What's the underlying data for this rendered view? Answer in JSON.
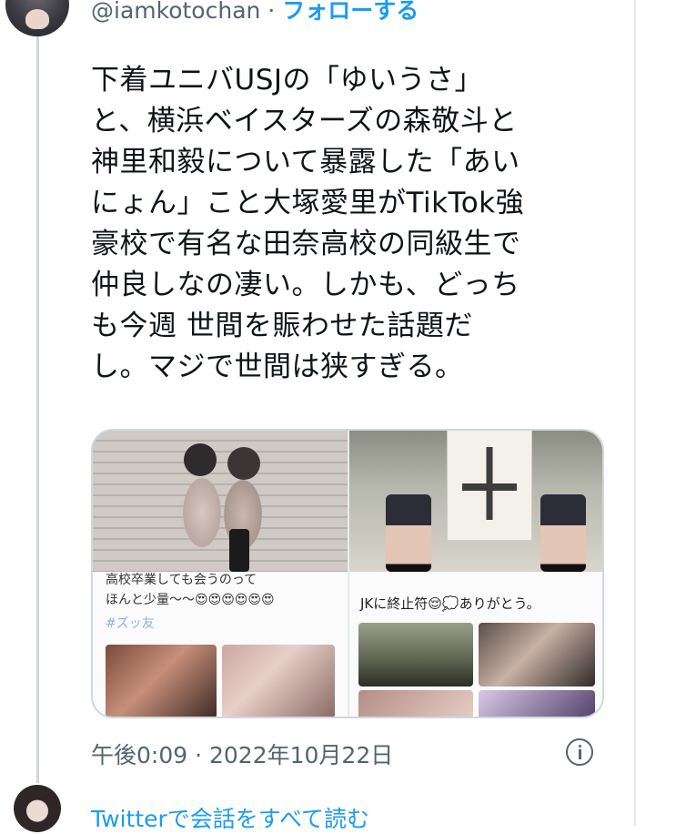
{
  "tweet": {
    "handle": "@iamkotochan",
    "separator": "·",
    "follow_label": "フォローする",
    "text_lines": [
      "下着ユニバUSJの「ゆいうさ」",
      "と、横浜ベイスターズの森敬斗と",
      "神里和毅について暴露した「あい",
      "にょん」こと大塚愛里がTikTok強",
      "豪校で有名な田奈高校の同級生で",
      "仲良しなの凄い。しかも、どっち",
      "も今週 世間を賑わせた話題だ",
      "し。マジで世間は狭すぎる。"
    ],
    "timestamp": "午後0:09 · 2022年10月22日"
  },
  "media": {
    "left_caption_line1": "高校卒業しても会うのって",
    "left_caption_line2": "ほんと少量〜〜😍😍😍😍😍😍",
    "left_hashtag": "#ズッ友",
    "right_caption": "JKに終止符😌💭ありがとう。"
  },
  "thread": {
    "view_all_label": "Twitterで会話をすべて読む"
  },
  "icons": {
    "info": "info-icon"
  },
  "colors": {
    "link": "#1d9bf0",
    "muted": "#536471",
    "text": "#0f1419",
    "thread_line": "#cfd6dc"
  }
}
